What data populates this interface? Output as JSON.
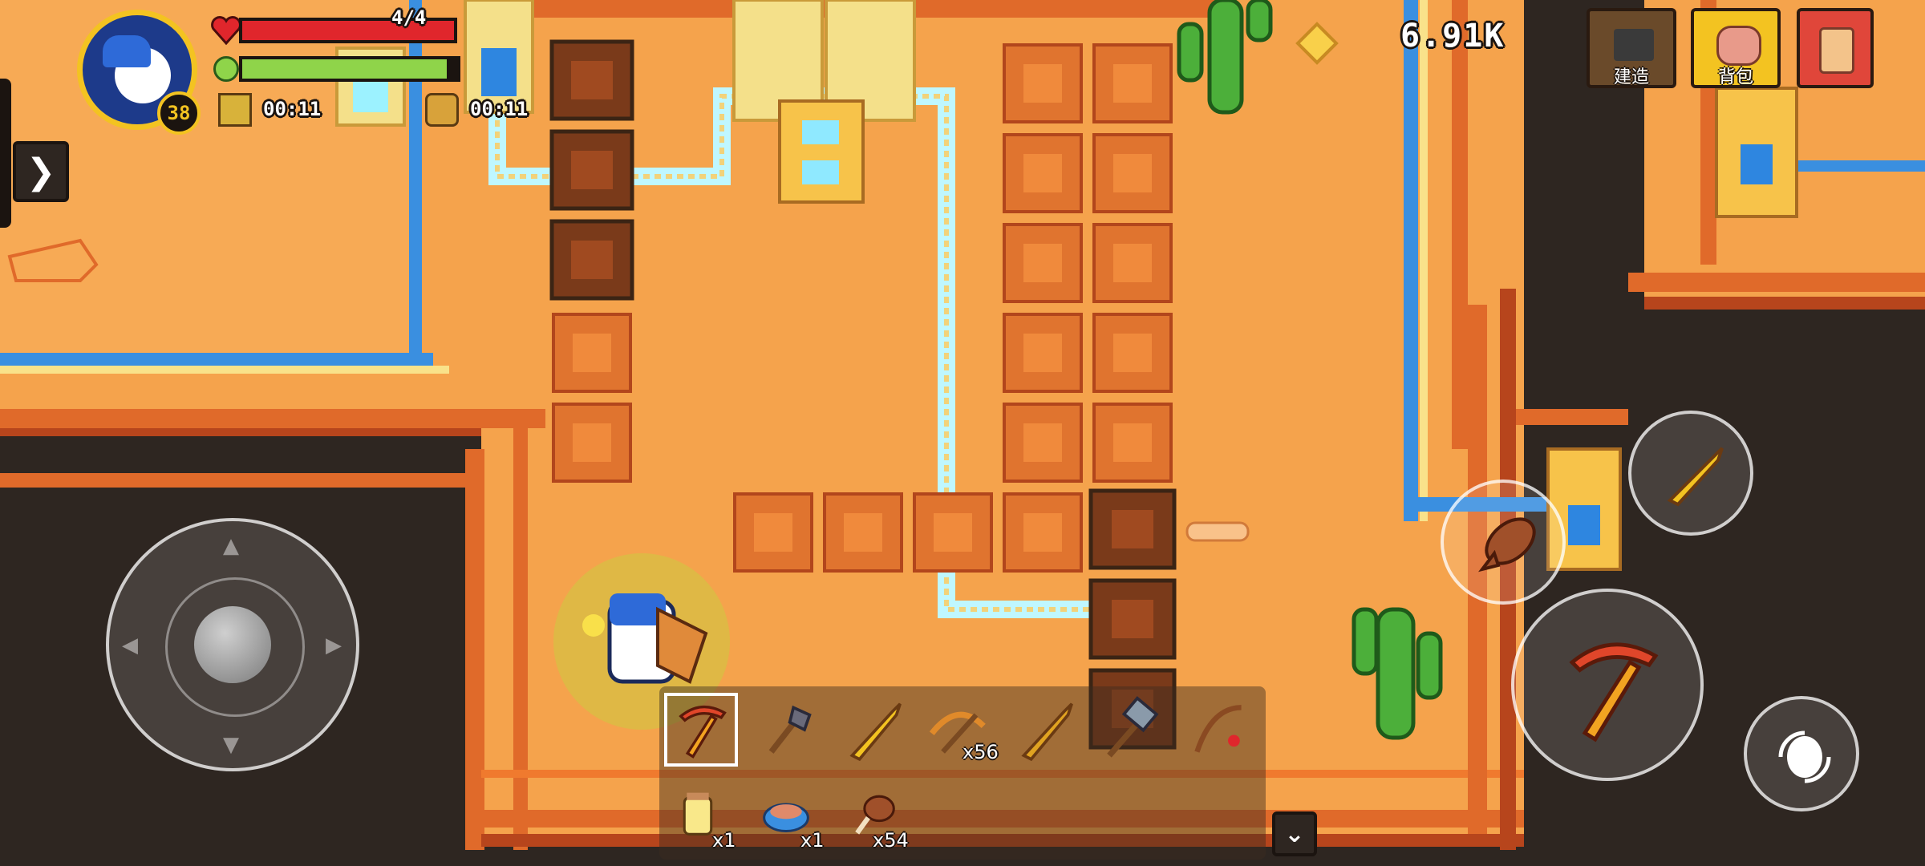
{
  "player": {
    "level": "38",
    "health_text": "4/4",
    "health_fraction": 1.0,
    "energy_fraction": 0.95,
    "buff_timers": [
      "00:11",
      "00:11"
    ]
  },
  "currency": {
    "amount": "6.91K"
  },
  "top_buttons": {
    "build_label": "建造",
    "backpack_label": "背包"
  },
  "hotbar": {
    "selected_index": 0,
    "items": [
      {
        "icon": "pickaxe-icon",
        "count": ""
      },
      {
        "icon": "shovel-icon",
        "count": ""
      },
      {
        "icon": "sword-icon",
        "count": ""
      },
      {
        "icon": "crossbow-icon",
        "count": "x56"
      },
      {
        "icon": "golden-sword-icon",
        "count": ""
      },
      {
        "icon": "hammer-icon",
        "count": ""
      },
      {
        "icon": "fishing-rod-icon",
        "count": ""
      }
    ]
  },
  "consumables": [
    {
      "icon": "jar-icon",
      "count": "x1"
    },
    {
      "icon": "food-bowl-icon",
      "count": "x1"
    },
    {
      "icon": "drumstick-icon",
      "count": "x54"
    }
  ],
  "colors": {
    "sand": "#f5a34c",
    "wall": "#e06a2a",
    "dark_ground": "#2e2621",
    "water_blue": "#3a8fe0",
    "health_red": "#e0262c",
    "energy_green": "#8fd44a",
    "cactus_green": "#4caf3a"
  }
}
